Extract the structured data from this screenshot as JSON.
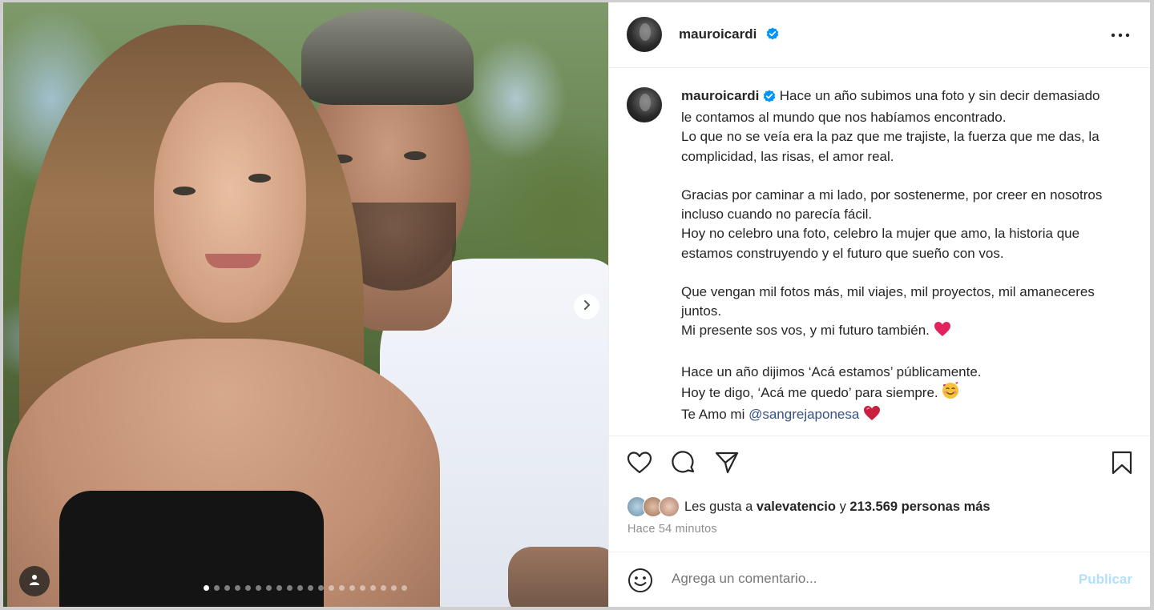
{
  "post": {
    "username": "mauroicardi",
    "more_icon": "more-horizontal-icon"
  },
  "media": {
    "next_icon": "chevron-right-icon",
    "tag_icon": "user-tag-icon",
    "carousel_count": 20,
    "carousel_active_index": 0
  },
  "caption": {
    "username": "mauroicardi",
    "lines": [
      "Hace un año subimos una foto y sin decir demasiado le contamos al mundo que nos habíamos encontrado.",
      "Lo que no se veía era la paz que me trajiste, la fuerza que me das, la complicidad, las risas, el amor real.",
      "",
      "Gracias por caminar a mi lado, por sostenerme, por creer en nosotros incluso cuando no parecía fácil.",
      "Hoy no celebro una foto, celebro la mujer que amo, la historia que estamos construyendo y el futuro que sueño con vos.",
      "",
      "Que vengan mil fotos más, mil viajes, mil proyectos, mil amaneceres juntos.",
      "Mi presente sos vos, y mi futuro también.",
      "",
      "Hace un año dijimos ‘Acá estamos’ públicamente.",
      "Hoy te digo, ‘Acá me quedo’ para siempre.",
      "Te Amo mi"
    ],
    "mention": "@sangrejaponesa"
  },
  "actions": {
    "like_icon": "heart-icon",
    "comment_icon": "comment-icon",
    "share_icon": "send-icon",
    "save_icon": "bookmark-icon"
  },
  "likes": {
    "prefix": "Les gusta a",
    "first_user": "valevatencio",
    "joiner": "y",
    "others": "213.569 personas más"
  },
  "time_ago": "Hace 54 minutos",
  "comment": {
    "placeholder": "Agrega un comentario...",
    "publish_label": "Publicar",
    "emoji_icon": "smiley-icon"
  },
  "colors": {
    "verified": "#0095f6",
    "mention": "#385185",
    "publish_disabled": "#b2dffc",
    "heart_emoji": "#e0245e"
  }
}
